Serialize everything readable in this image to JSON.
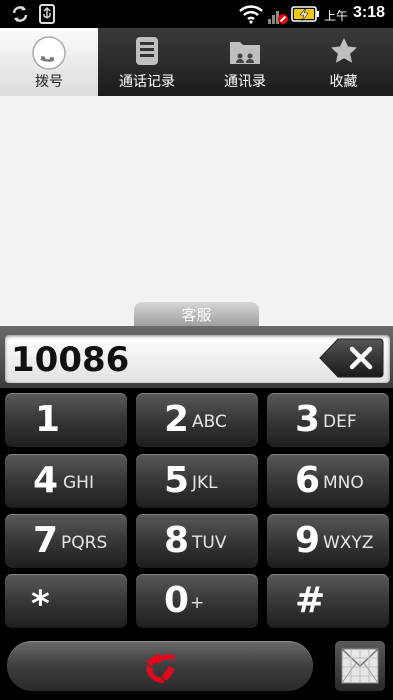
{
  "status_bar": {
    "ampm": "上午",
    "time": "3:18",
    "icons": [
      "sync-icon",
      "usb-icon",
      "wifi-icon",
      "signal-icon",
      "battery-charging-icon"
    ]
  },
  "tabs": [
    {
      "label": "拨号",
      "icon": "phone-icon",
      "active": true
    },
    {
      "label": "通话记录",
      "icon": "call-log-icon",
      "active": false
    },
    {
      "label": "通讯录",
      "icon": "contacts-icon",
      "active": false
    },
    {
      "label": "收藏",
      "icon": "star-icon",
      "active": false
    }
  ],
  "suggestion": {
    "label": "客服"
  },
  "number_display": {
    "value": "10086"
  },
  "keypad": [
    {
      "digit": "1",
      "letters": ""
    },
    {
      "digit": "2",
      "letters": "ABC"
    },
    {
      "digit": "3",
      "letters": "DEF"
    },
    {
      "digit": "4",
      "letters": "GHI"
    },
    {
      "digit": "5",
      "letters": "JKL"
    },
    {
      "digit": "6",
      "letters": "MNO"
    },
    {
      "digit": "7",
      "letters": "PQRS"
    },
    {
      "digit": "8",
      "letters": "TUV"
    },
    {
      "digit": "9",
      "letters": "WXYZ"
    },
    {
      "digit": "*",
      "letters": ""
    },
    {
      "digit": "0",
      "letters": "+"
    },
    {
      "digit": "#",
      "letters": ""
    }
  ],
  "bottom_bar": {
    "call_icon": "phone-handset-icon",
    "sms_icon": "message-icon"
  },
  "colors": {
    "call_icon": "#e8001c",
    "active_tab_bg": "#f0f0f0",
    "key_bg": "#3a3a3a"
  }
}
